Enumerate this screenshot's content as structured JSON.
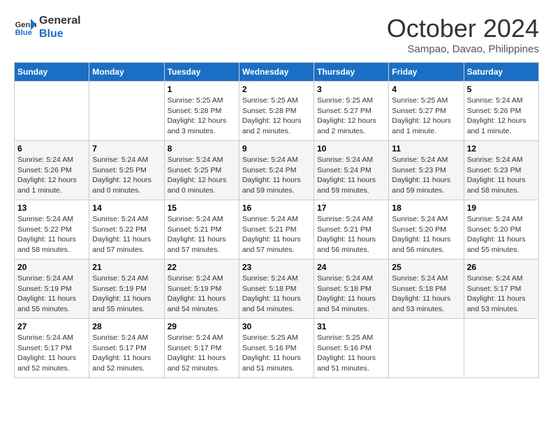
{
  "logo": {
    "line1": "General",
    "line2": "Blue"
  },
  "title": "October 2024",
  "subtitle": "Sampao, Davao, Philippines",
  "days_header": [
    "Sunday",
    "Monday",
    "Tuesday",
    "Wednesday",
    "Thursday",
    "Friday",
    "Saturday"
  ],
  "weeks": [
    [
      {
        "day": "",
        "detail": ""
      },
      {
        "day": "",
        "detail": ""
      },
      {
        "day": "1",
        "detail": "Sunrise: 5:25 AM\nSunset: 5:28 PM\nDaylight: 12 hours\nand 3 minutes."
      },
      {
        "day": "2",
        "detail": "Sunrise: 5:25 AM\nSunset: 5:28 PM\nDaylight: 12 hours\nand 2 minutes."
      },
      {
        "day": "3",
        "detail": "Sunrise: 5:25 AM\nSunset: 5:27 PM\nDaylight: 12 hours\nand 2 minutes."
      },
      {
        "day": "4",
        "detail": "Sunrise: 5:25 AM\nSunset: 5:27 PM\nDaylight: 12 hours\nand 1 minute."
      },
      {
        "day": "5",
        "detail": "Sunrise: 5:24 AM\nSunset: 5:26 PM\nDaylight: 12 hours\nand 1 minute."
      }
    ],
    [
      {
        "day": "6",
        "detail": "Sunrise: 5:24 AM\nSunset: 5:26 PM\nDaylight: 12 hours\nand 1 minute."
      },
      {
        "day": "7",
        "detail": "Sunrise: 5:24 AM\nSunset: 5:25 PM\nDaylight: 12 hours\nand 0 minutes."
      },
      {
        "day": "8",
        "detail": "Sunrise: 5:24 AM\nSunset: 5:25 PM\nDaylight: 12 hours\nand 0 minutes."
      },
      {
        "day": "9",
        "detail": "Sunrise: 5:24 AM\nSunset: 5:24 PM\nDaylight: 11 hours\nand 59 minutes."
      },
      {
        "day": "10",
        "detail": "Sunrise: 5:24 AM\nSunset: 5:24 PM\nDaylight: 11 hours\nand 59 minutes."
      },
      {
        "day": "11",
        "detail": "Sunrise: 5:24 AM\nSunset: 5:23 PM\nDaylight: 11 hours\nand 59 minutes."
      },
      {
        "day": "12",
        "detail": "Sunrise: 5:24 AM\nSunset: 5:23 PM\nDaylight: 11 hours\nand 58 minutes."
      }
    ],
    [
      {
        "day": "13",
        "detail": "Sunrise: 5:24 AM\nSunset: 5:22 PM\nDaylight: 11 hours\nand 58 minutes."
      },
      {
        "day": "14",
        "detail": "Sunrise: 5:24 AM\nSunset: 5:22 PM\nDaylight: 11 hours\nand 57 minutes."
      },
      {
        "day": "15",
        "detail": "Sunrise: 5:24 AM\nSunset: 5:21 PM\nDaylight: 11 hours\nand 57 minutes."
      },
      {
        "day": "16",
        "detail": "Sunrise: 5:24 AM\nSunset: 5:21 PM\nDaylight: 11 hours\nand 57 minutes."
      },
      {
        "day": "17",
        "detail": "Sunrise: 5:24 AM\nSunset: 5:21 PM\nDaylight: 11 hours\nand 56 minutes."
      },
      {
        "day": "18",
        "detail": "Sunrise: 5:24 AM\nSunset: 5:20 PM\nDaylight: 11 hours\nand 56 minutes."
      },
      {
        "day": "19",
        "detail": "Sunrise: 5:24 AM\nSunset: 5:20 PM\nDaylight: 11 hours\nand 55 minutes."
      }
    ],
    [
      {
        "day": "20",
        "detail": "Sunrise: 5:24 AM\nSunset: 5:19 PM\nDaylight: 11 hours\nand 55 minutes."
      },
      {
        "day": "21",
        "detail": "Sunrise: 5:24 AM\nSunset: 5:19 PM\nDaylight: 11 hours\nand 55 minutes."
      },
      {
        "day": "22",
        "detail": "Sunrise: 5:24 AM\nSunset: 5:19 PM\nDaylight: 11 hours\nand 54 minutes."
      },
      {
        "day": "23",
        "detail": "Sunrise: 5:24 AM\nSunset: 5:18 PM\nDaylight: 11 hours\nand 54 minutes."
      },
      {
        "day": "24",
        "detail": "Sunrise: 5:24 AM\nSunset: 5:18 PM\nDaylight: 11 hours\nand 54 minutes."
      },
      {
        "day": "25",
        "detail": "Sunrise: 5:24 AM\nSunset: 5:18 PM\nDaylight: 11 hours\nand 53 minutes."
      },
      {
        "day": "26",
        "detail": "Sunrise: 5:24 AM\nSunset: 5:17 PM\nDaylight: 11 hours\nand 53 minutes."
      }
    ],
    [
      {
        "day": "27",
        "detail": "Sunrise: 5:24 AM\nSunset: 5:17 PM\nDaylight: 11 hours\nand 52 minutes."
      },
      {
        "day": "28",
        "detail": "Sunrise: 5:24 AM\nSunset: 5:17 PM\nDaylight: 11 hours\nand 52 minutes."
      },
      {
        "day": "29",
        "detail": "Sunrise: 5:24 AM\nSunset: 5:17 PM\nDaylight: 11 hours\nand 52 minutes."
      },
      {
        "day": "30",
        "detail": "Sunrise: 5:25 AM\nSunset: 5:16 PM\nDaylight: 11 hours\nand 51 minutes."
      },
      {
        "day": "31",
        "detail": "Sunrise: 5:25 AM\nSunset: 5:16 PM\nDaylight: 11 hours\nand 51 minutes."
      },
      {
        "day": "",
        "detail": ""
      },
      {
        "day": "",
        "detail": ""
      }
    ]
  ]
}
